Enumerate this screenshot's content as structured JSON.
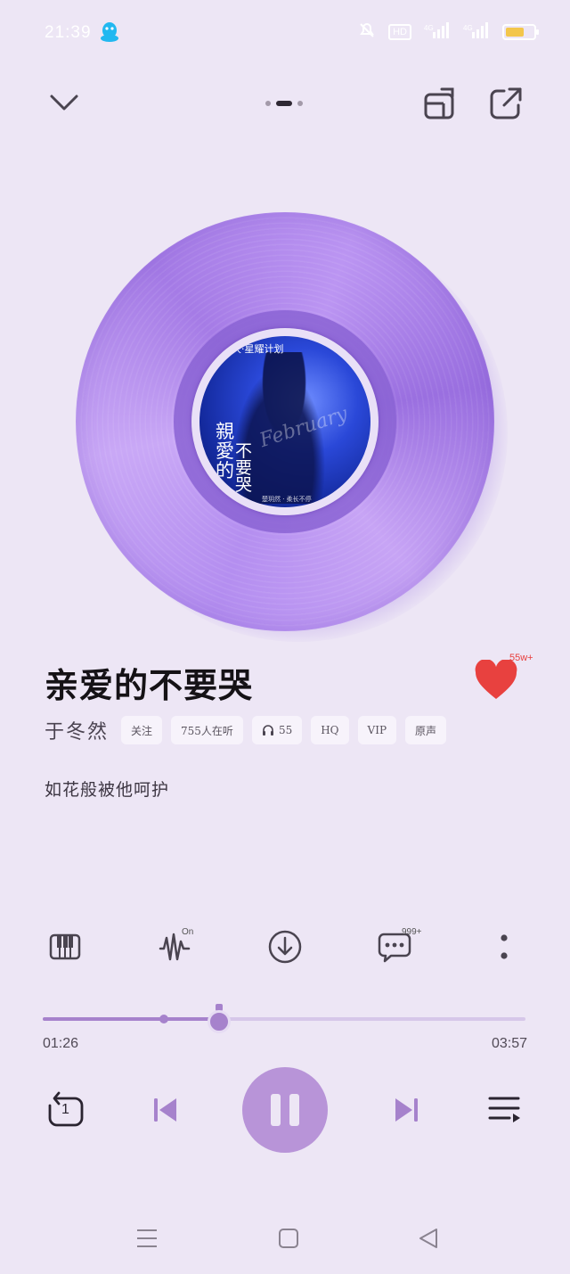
{
  "status_bar": {
    "time": "21:39",
    "hd_label": "HD",
    "battery_label": "",
    "icons": [
      "qq-penguin-icon",
      "mute-bell-icon",
      "hd-icon",
      "signal-icon",
      "battery-icon"
    ]
  },
  "top_nav": {
    "collapse_icon": "chevron-down-icon",
    "page_dots": {
      "count": 3,
      "active": 1
    },
    "actions": [
      "screen-cast-icon",
      "share-icon"
    ]
  },
  "album": {
    "cover_text": {
      "series": "大·星耀计划",
      "title_left": "親愛的",
      "title_right": "不要哭",
      "script": "February",
      "credits": "楚玥然 · 柔长不停"
    },
    "colors": {
      "vinyl": "#b48ef0",
      "cover": "#1f3bc4"
    }
  },
  "song": {
    "title": "亲爱的不要哭",
    "like_count": "55w+",
    "artist": "于冬然",
    "tags": [
      {
        "label": "关注"
      },
      {
        "label": "755人在听"
      },
      {
        "label": "55",
        "icon": "headphones-icon"
      },
      {
        "label": "HQ"
      },
      {
        "label": "VIP"
      },
      {
        "label": "原声"
      }
    ],
    "lyric": "如花般被他呵护"
  },
  "toolbar": {
    "items": [
      {
        "name": "piano-icon"
      },
      {
        "name": "sound-effect-icon",
        "badge": "On"
      },
      {
        "name": "download-icon"
      },
      {
        "name": "comments-icon",
        "badge": "999+"
      },
      {
        "name": "more-icon"
      }
    ]
  },
  "progress": {
    "current": "01:26",
    "total": "03:57",
    "played_fraction": 0.363,
    "buffered_fraction": 0.242
  },
  "playback": {
    "mode": "repeat-one-icon",
    "mode_badge": "1",
    "controls": [
      "previous-icon",
      "pause-icon",
      "next-icon",
      "playlist-icon"
    ]
  },
  "system_nav": [
    "menu-icon",
    "home-icon",
    "back-icon"
  ],
  "colors": {
    "background": "#ede6f5",
    "accent": "#a682cc",
    "heart": "#e8413f"
  }
}
